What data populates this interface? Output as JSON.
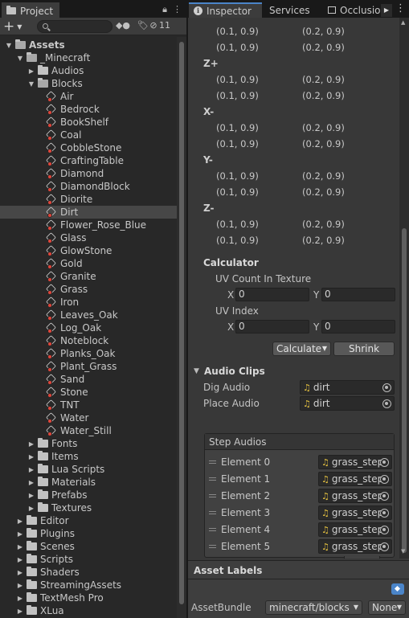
{
  "project": {
    "tab_label": "Project",
    "hidden_count": "11",
    "tree": [
      {
        "label": "Assets",
        "depth": 0,
        "arrow": "open",
        "icon": "folder-open",
        "bold": true
      },
      {
        "label": "_Minecraft",
        "depth": 1,
        "arrow": "open",
        "icon": "folder-open"
      },
      {
        "label": "Audios",
        "depth": 2,
        "arrow": "closed",
        "icon": "folder"
      },
      {
        "label": "Blocks",
        "depth": 2,
        "arrow": "open",
        "icon": "folder-open"
      },
      {
        "label": "Air",
        "depth": 3,
        "arrow": "none",
        "icon": "block"
      },
      {
        "label": "Bedrock",
        "depth": 3,
        "arrow": "none",
        "icon": "block"
      },
      {
        "label": "BookShelf",
        "depth": 3,
        "arrow": "none",
        "icon": "block"
      },
      {
        "label": "Coal",
        "depth": 3,
        "arrow": "none",
        "icon": "block"
      },
      {
        "label": "CobbleStone",
        "depth": 3,
        "arrow": "none",
        "icon": "block"
      },
      {
        "label": "CraftingTable",
        "depth": 3,
        "arrow": "none",
        "icon": "block"
      },
      {
        "label": "Diamond",
        "depth": 3,
        "arrow": "none",
        "icon": "block"
      },
      {
        "label": "DiamondBlock",
        "depth": 3,
        "arrow": "none",
        "icon": "block"
      },
      {
        "label": "Diorite",
        "depth": 3,
        "arrow": "none",
        "icon": "block"
      },
      {
        "label": "Dirt",
        "depth": 3,
        "arrow": "none",
        "icon": "block",
        "selected": true
      },
      {
        "label": "Flower_Rose_Blue",
        "depth": 3,
        "arrow": "none",
        "icon": "block"
      },
      {
        "label": "Glass",
        "depth": 3,
        "arrow": "none",
        "icon": "block"
      },
      {
        "label": "GlowStone",
        "depth": 3,
        "arrow": "none",
        "icon": "block"
      },
      {
        "label": "Gold",
        "depth": 3,
        "arrow": "none",
        "icon": "block"
      },
      {
        "label": "Granite",
        "depth": 3,
        "arrow": "none",
        "icon": "block"
      },
      {
        "label": "Grass",
        "depth": 3,
        "arrow": "none",
        "icon": "block"
      },
      {
        "label": "Iron",
        "depth": 3,
        "arrow": "none",
        "icon": "block"
      },
      {
        "label": "Leaves_Oak",
        "depth": 3,
        "arrow": "none",
        "icon": "block"
      },
      {
        "label": "Log_Oak",
        "depth": 3,
        "arrow": "none",
        "icon": "block"
      },
      {
        "label": "Noteblock",
        "depth": 3,
        "arrow": "none",
        "icon": "block"
      },
      {
        "label": "Planks_Oak",
        "depth": 3,
        "arrow": "none",
        "icon": "block"
      },
      {
        "label": "Plant_Grass",
        "depth": 3,
        "arrow": "none",
        "icon": "block"
      },
      {
        "label": "Sand",
        "depth": 3,
        "arrow": "none",
        "icon": "block"
      },
      {
        "label": "Stone",
        "depth": 3,
        "arrow": "none",
        "icon": "block"
      },
      {
        "label": "TNT",
        "depth": 3,
        "arrow": "none",
        "icon": "block"
      },
      {
        "label": "Water",
        "depth": 3,
        "arrow": "none",
        "icon": "block"
      },
      {
        "label": "Water_Still",
        "depth": 3,
        "arrow": "none",
        "icon": "block"
      },
      {
        "label": "Fonts",
        "depth": 2,
        "arrow": "closed",
        "icon": "folder"
      },
      {
        "label": "Items",
        "depth": 2,
        "arrow": "closed",
        "icon": "folder"
      },
      {
        "label": "Lua Scripts",
        "depth": 2,
        "arrow": "closed",
        "icon": "folder"
      },
      {
        "label": "Materials",
        "depth": 2,
        "arrow": "closed",
        "icon": "folder"
      },
      {
        "label": "Prefabs",
        "depth": 2,
        "arrow": "closed",
        "icon": "folder"
      },
      {
        "label": "Textures",
        "depth": 2,
        "arrow": "closed",
        "icon": "folder"
      },
      {
        "label": "Editor",
        "depth": 1,
        "arrow": "closed",
        "icon": "folder"
      },
      {
        "label": "Plugins",
        "depth": 1,
        "arrow": "closed",
        "icon": "folder"
      },
      {
        "label": "Scenes",
        "depth": 1,
        "arrow": "closed",
        "icon": "folder"
      },
      {
        "label": "Scripts",
        "depth": 1,
        "arrow": "closed",
        "icon": "folder"
      },
      {
        "label": "Shaders",
        "depth": 1,
        "arrow": "closed",
        "icon": "folder"
      },
      {
        "label": "StreamingAssets",
        "depth": 1,
        "arrow": "closed",
        "icon": "folder"
      },
      {
        "label": "TextMesh Pro",
        "depth": 1,
        "arrow": "closed",
        "icon": "folder"
      },
      {
        "label": "XLua",
        "depth": 1,
        "arrow": "closed",
        "icon": "folder"
      }
    ]
  },
  "inspector": {
    "tabs": [
      "Inspector",
      "Services",
      "Occlusio"
    ],
    "uv_rows": [
      {
        "face": "",
        "a": [
          "(0.1, 0.9)",
          "(0.1, 0.9)"
        ],
        "b": [
          "(0.2, 0.9)",
          "(0.2, 0.9)"
        ]
      },
      {
        "face": "Z+",
        "a": [
          "(0.1, 0.9)",
          "(0.1, 0.9)"
        ],
        "b": [
          "(0.2, 0.9)",
          "(0.2, 0.9)"
        ]
      },
      {
        "face": "X-",
        "a": [
          "(0.1, 0.9)",
          "(0.1, 0.9)"
        ],
        "b": [
          "(0.2, 0.9)",
          "(0.2, 0.9)"
        ]
      },
      {
        "face": "Y-",
        "a": [
          "(0.1, 0.9)",
          "(0.1, 0.9)"
        ],
        "b": [
          "(0.2, 0.9)",
          "(0.2, 0.9)"
        ]
      },
      {
        "face": "Z-",
        "a": [
          "(0.1, 0.9)",
          "(0.1, 0.9)"
        ],
        "b": [
          "(0.2, 0.9)",
          "(0.2, 0.9)"
        ]
      }
    ],
    "calculator": {
      "heading": "Calculator",
      "uv_count_label": "UV Count In Texture",
      "uv_count_x": "0",
      "uv_count_y": "0",
      "uv_index_label": "UV Index",
      "uv_index_x": "0",
      "uv_index_y": "0",
      "x_label": "X",
      "y_label": "Y",
      "calculate_label": "Calculate",
      "shrink_label": "Shrink"
    },
    "audio": {
      "heading": "Audio Clips",
      "dig_label": "Dig Audio",
      "dig_value": "dirt",
      "place_label": "Place Audio",
      "place_value": "dirt",
      "step_heading": "Step Audios",
      "elements": [
        {
          "name": "Element 0",
          "value": "grass_step"
        },
        {
          "name": "Element 1",
          "value": "grass_step"
        },
        {
          "name": "Element 2",
          "value": "grass_step"
        },
        {
          "name": "Element 3",
          "value": "grass_step"
        },
        {
          "name": "Element 4",
          "value": "grass_step"
        },
        {
          "name": "Element 5",
          "value": "grass_step"
        }
      ],
      "add_label": "+",
      "remove_label": "−"
    },
    "asset_labels": {
      "heading": "Asset Labels",
      "bundle_label": "AssetBundle",
      "bundle_value": "minecraft/blocks",
      "variant_value": "None"
    }
  }
}
